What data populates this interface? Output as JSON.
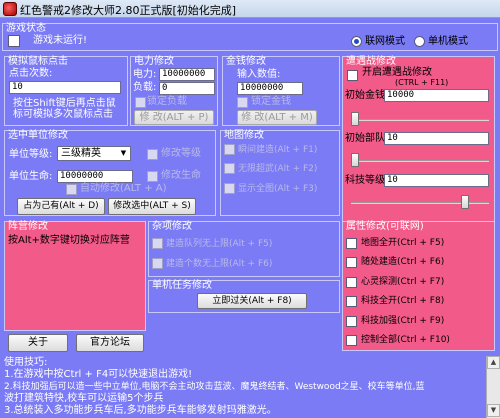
{
  "window": {
    "title": "红色警戒2修改大师2.80正式版[初始化完成]"
  },
  "game_status": {
    "title": "游戏状态",
    "status_text": "游戏未运行!",
    "modes": [
      {
        "label": "联网模式",
        "selected": true
      },
      {
        "label": "单机模式",
        "selected": false
      }
    ]
  },
  "mouse_sim": {
    "title": "模拟鼠标点击",
    "clicks_label": "点击次数:",
    "clicks_value": "10",
    "hint_line1": "按住Shift键后再点击鼠",
    "hint_line2": "标可模拟多次鼠标点击"
  },
  "power": {
    "title": "电力修改",
    "power_label": "电力:",
    "power_value": "10000000",
    "load_label": "负载:",
    "load_value": "0",
    "lock_label": "锁定负载",
    "modify_button": "修 改(ALT + P)"
  },
  "money": {
    "title": "金钱修改",
    "input_label": "输入数值:",
    "input_value": "10000000",
    "lock_label": "锁定金钱",
    "modify_button": "修 改(ALT + M)"
  },
  "encounter": {
    "title": "遭遇战修改",
    "enable_label": "开启遭遇战修改",
    "enable_hotkey": "(CTRL + F11)",
    "initial_money_label": "初始金钱",
    "initial_money_value": "10000",
    "initial_units_label": "初始部队",
    "initial_units_value": "10",
    "tech_level_label": "科技等级",
    "tech_level_value": "10"
  },
  "unit_mod": {
    "title": "选中单位修改",
    "level_label": "单位等级:",
    "level_value": "三级精英",
    "level_check": "修改等级",
    "hp_label": "单位生命:",
    "hp_value": "10000000",
    "hp_check": "修改生命",
    "auto_check": "自动修改(ALT + A)",
    "own_button": "占为己有(Alt + D)",
    "modify_button": "修改选中(ALT + S)"
  },
  "map_mod": {
    "title": "地图修改",
    "items": [
      "瞬间建造(Alt + F1)",
      "无限超武(Alt + F2)",
      "显示全图(Alt + F3)"
    ]
  },
  "camp": {
    "title": "阵营修改",
    "hint": "按Alt+数字键切换对应阵营"
  },
  "misc": {
    "title": "杂项修改",
    "items": [
      "建造队列无上限(Alt + F5)",
      "建造个数无上限(Alt + F6)"
    ]
  },
  "mission": {
    "title": "单机任务修改",
    "button": "立即过关(Alt + F8)"
  },
  "attribute": {
    "title": "属性修改(可联网)",
    "items": [
      "地图全开(Ctrl + F5)",
      "随处建造(Ctrl + F6)",
      "心灵探测(Ctrl + F7)",
      "科技全开(Ctrl + F8)",
      "科技加强(Ctrl + F9)",
      "控制全部(Ctrl + F10)"
    ]
  },
  "bottom": {
    "about_button": "关于",
    "forum_button": "官方论坛"
  },
  "help": {
    "lines": [
      "使用技巧:",
      "1.在游戏中按Ctrl + F4可以快速退出游戏!",
      "2.科技加强后可以造一些中立单位,电脑不会主动攻击蓝波、魔鬼终结者、Westwood之星、校车等单位,蓝",
      "波打建筑特快,校车可以运输5个步兵",
      "3.总统装入多功能步兵车后,多功能步兵车能够发射玛雅激光。"
    ]
  },
  "colors": {
    "client_bg": "#7b7bf6",
    "pink": "#f25a8a",
    "border": "#c8c8ff",
    "text": "#ffffff"
  }
}
